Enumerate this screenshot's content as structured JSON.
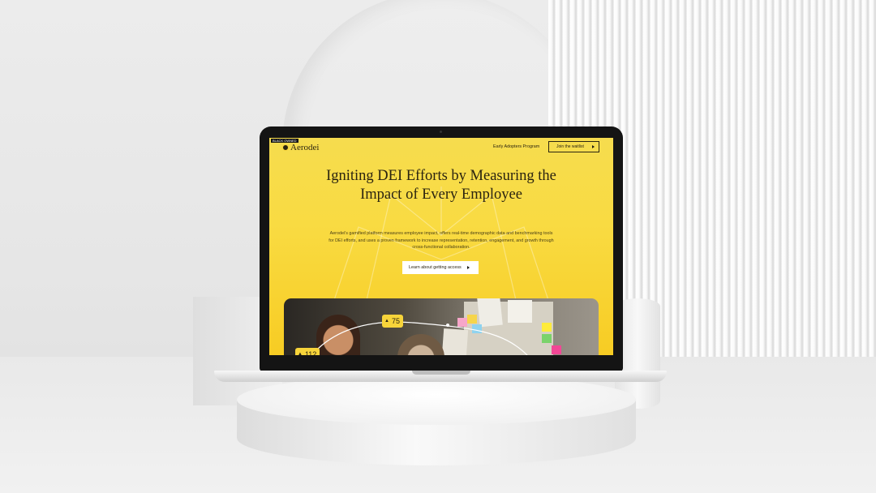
{
  "website": {
    "badge_tag": "BLACK OWNED",
    "logo": "Aerodei",
    "nav": {
      "link": "Early Adopters Program",
      "button": "Join the waitlist"
    },
    "hero": {
      "title": "Igniting DEI Efforts by Measuring the Impact of Every Employee",
      "description": "Aerodei's gamified platform measures employee impact, offers real-time demographic data and benchmarking tools for DEI efforts, and uses a proven framework to increase representation, retention, engagement, and growth through cross-functional collaboration.",
      "cta": "Learn about getting access"
    },
    "photo_badges": [
      {
        "icon": "trophy-icon",
        "value": "75"
      },
      {
        "icon": "trophy-icon",
        "value": "112"
      }
    ]
  },
  "colors": {
    "brand_yellow": "#f7d43a",
    "ink": "#2b2410",
    "backdrop": "#e9e9e9"
  }
}
